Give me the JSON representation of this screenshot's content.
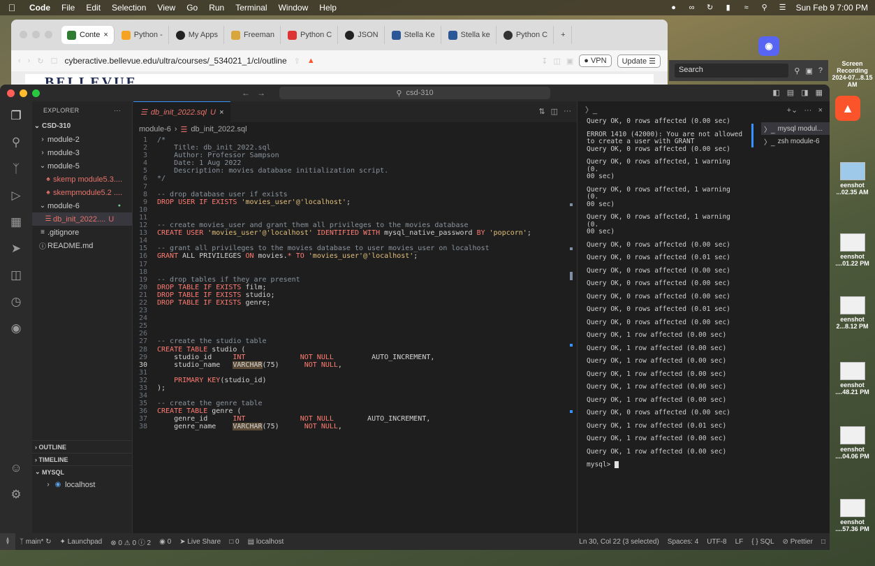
{
  "menubar": {
    "items": [
      "Code",
      "File",
      "Edit",
      "Selection",
      "View",
      "Go",
      "Run",
      "Terminal",
      "Window",
      "Help"
    ],
    "clock": "Sun Feb 9  7:00 PM"
  },
  "browser": {
    "tabs": [
      "Conte",
      "Python -",
      "My Apps",
      "Freeman",
      "Python C",
      "JSON",
      "Stella Ke",
      "Stella ke",
      "Python C"
    ],
    "url": "cyberactive.bellevue.edu/ultra/courses/_534021_1/cl/outline",
    "vpn": "VPN",
    "update": "Update",
    "logo": "BELLEVUE"
  },
  "widget": {
    "search": "Search"
  },
  "vscode": {
    "command_center": "csd-310",
    "explorer": {
      "header": "EXPLORER",
      "root": "CSD-310",
      "items": [
        {
          "label": "module-2",
          "indent": 1,
          "icon": "chevron-right"
        },
        {
          "label": "module-3",
          "indent": 1,
          "icon": "chevron-right"
        },
        {
          "label": "module-5",
          "indent": 1,
          "icon": "chevron-down"
        },
        {
          "label": "skemp module5.3....",
          "indent": 2,
          "icon": "python"
        },
        {
          "label": "skempmodule5.2 ....",
          "indent": 2,
          "icon": "python"
        },
        {
          "label": "module-6",
          "indent": 1,
          "icon": "chevron-down"
        },
        {
          "label": "db_init_2022....",
          "indent": 2,
          "icon": "sql",
          "badge": "U"
        },
        {
          "label": ".gitignore",
          "indent": 1,
          "icon": "lines"
        },
        {
          "label": "README.md",
          "indent": 1,
          "icon": "info"
        }
      ],
      "sections": [
        "OUTLINE",
        "TIMELINE",
        "MYSQL"
      ],
      "mysql_host": "localhost"
    },
    "editor": {
      "tab": "db_init_2022.sql",
      "tab_badge": "U",
      "breadcrumb_folder": "module-6",
      "breadcrumb_file": "db_init_2022.sql",
      "lines": [
        [
          [
            "c-com",
            "/*"
          ]
        ],
        [
          [
            "c-com",
            "    Title: db_init_2022.sql"
          ]
        ],
        [
          [
            "c-com",
            "    Author: Professor Sampson"
          ]
        ],
        [
          [
            "c-com",
            "    Date: 1 Aug 2022"
          ]
        ],
        [
          [
            "c-com",
            "    Description: movies database initialization script."
          ]
        ],
        [
          [
            "c-com",
            "*/"
          ]
        ],
        [],
        [
          [
            "c-com",
            "-- drop database user if exists"
          ]
        ],
        [
          [
            "c-kw",
            "DROP USER IF EXISTS "
          ],
          [
            "c-str",
            "'movies_user'@'localhost'"
          ],
          [
            "c-id",
            ";"
          ]
        ],
        [],
        [],
        [
          [
            "c-com",
            "-- create movies_user and grant them all privileges to the movies database"
          ]
        ],
        [
          [
            "c-kw",
            "CREATE USER "
          ],
          [
            "c-str",
            "'movies_user'@'localhost'"
          ],
          [
            "c-kw",
            " IDENTIFIED WITH "
          ],
          [
            "c-id",
            "mysql_native_password "
          ],
          [
            "c-kw",
            "BY "
          ],
          [
            "c-str",
            "'popcorn'"
          ],
          [
            "c-id",
            ";"
          ]
        ],
        [],
        [
          [
            "c-com",
            "-- grant all privileges to the movies database to user movies_user on localhost"
          ]
        ],
        [
          [
            "c-kw",
            "GRANT "
          ],
          [
            "c-id",
            "ALL PRIVILEGES "
          ],
          [
            "c-kw",
            "ON "
          ],
          [
            "c-id",
            "movies."
          ],
          [
            "c-kw",
            "*"
          ],
          [
            "c-kw",
            " TO "
          ],
          [
            "c-str",
            "'movies_user'@'localhost'"
          ],
          [
            "c-id",
            ";"
          ]
        ],
        [],
        [],
        [
          [
            "c-com",
            "-- drop tables if they are present"
          ]
        ],
        [
          [
            "c-kw",
            "DROP TABLE IF EXISTS "
          ],
          [
            "c-id",
            "film;"
          ]
        ],
        [
          [
            "c-kw",
            "DROP TABLE IF EXISTS "
          ],
          [
            "c-id",
            "studio;"
          ]
        ],
        [
          [
            "c-kw",
            "DROP TABLE IF EXISTS "
          ],
          [
            "c-id",
            "genre;"
          ]
        ],
        [],
        [],
        [],
        [],
        [
          [
            "c-com",
            "-- create the studio table"
          ]
        ],
        [
          [
            "c-kw",
            "CREATE TABLE "
          ],
          [
            "c-id",
            "studio ("
          ]
        ],
        [
          [
            "c-id",
            "    studio_id     "
          ],
          [
            "c-ty",
            "INT"
          ],
          [
            "c-id",
            "             "
          ],
          [
            "c-kw",
            "NOT NULL"
          ],
          [
            "c-id",
            "         AUTO_INCREMENT,"
          ]
        ],
        [
          [
            "c-id",
            "    studio_name   "
          ],
          [
            "c-hl",
            "VARCHAR"
          ],
          [
            "c-id",
            "(75)      "
          ],
          [
            "c-kw",
            "NOT NULL"
          ],
          [
            "c-id",
            ","
          ]
        ],
        [],
        [
          [
            "c-id",
            "    "
          ],
          [
            "c-kw",
            "PRIMARY KEY"
          ],
          [
            "c-id",
            "(studio_id)"
          ]
        ],
        [
          [
            "c-id",
            ");"
          ]
        ],
        [],
        [
          [
            "c-com",
            "-- create the genre table"
          ]
        ],
        [
          [
            "c-kw",
            "CREATE TABLE "
          ],
          [
            "c-id",
            "genre ("
          ]
        ],
        [
          [
            "c-id",
            "    genre_id      "
          ],
          [
            "c-ty",
            "INT"
          ],
          [
            "c-id",
            "             "
          ],
          [
            "c-kw",
            "NOT NULL"
          ],
          [
            "c-id",
            "        AUTO_INCREMENT,"
          ]
        ],
        [
          [
            "c-id",
            "    genre_name    "
          ],
          [
            "c-hl",
            "VARCHAR"
          ],
          [
            "c-id",
            "(75)      "
          ],
          [
            "c-kw",
            "NOT NULL"
          ],
          [
            "c-id",
            ","
          ]
        ]
      ],
      "current_line": 30
    },
    "terminal": {
      "output": [
        "Query OK, 0 rows affected (0.00 sec)",
        "",
        "ERROR 1410 (42000): You are not allowed\nto create a user with GRANT",
        "Query OK, 0 rows affected (0.00 sec)",
        "",
        "Query OK, 0 rows affected, 1 warning (0.\n00 sec)",
        "",
        "Query OK, 0 rows affected, 1 warning (0.\n00 sec)",
        "",
        "Query OK, 0 rows affected, 1 warning (0.\n00 sec)",
        "",
        "Query OK, 0 rows affected (0.00 sec)",
        "",
        "Query OK, 0 rows affected (0.01 sec)",
        "",
        "Query OK, 0 rows affected (0.00 sec)",
        "",
        "Query OK, 0 rows affected (0.00 sec)",
        "",
        "Query OK, 0 rows affected (0.00 sec)",
        "",
        "Query OK, 0 rows affected (0.01 sec)",
        "",
        "Query OK, 0 rows affected (0.00 sec)",
        "",
        "Query OK, 1 row affected (0.00 sec)",
        "",
        "Query OK, 1 row affected (0.00 sec)",
        "",
        "Query OK, 1 row affected (0.00 sec)",
        "",
        "Query OK, 1 row affected (0.00 sec)",
        "",
        "Query OK, 1 row affected (0.00 sec)",
        "",
        "Query OK, 1 row affected (0.00 sec)",
        "",
        "Query OK, 0 rows affected (0.00 sec)",
        "",
        "Query OK, 1 row affected (0.01 sec)",
        "",
        "Query OK, 1 row affected (0.00 sec)",
        "",
        "Query OK, 1 row affected (0.00 sec)",
        ""
      ],
      "prompt": "mysql> ",
      "sessions": [
        "mysql modul...",
        "zsh module-6"
      ]
    },
    "status": {
      "branch": "main*",
      "launchpad": "Launchpad",
      "problems": "⊗ 0 ⚠ 0 ⓘ 2",
      "ports": "0",
      "liveshare": "Live Share",
      "zero": "0",
      "db": "localhost",
      "position": "Ln 30, Col 22 (3 selected)",
      "spaces": "Spaces: 4",
      "encoding": "UTF-8",
      "eol": "LF",
      "lang": "SQL",
      "prettier": "Prettier"
    }
  },
  "desktop": {
    "items": [
      {
        "label": "Screen Recording\n2024-07...8.15 AM"
      },
      {
        "label": "eenshot\n...02.35 AM"
      },
      {
        "label": "eenshot\n....01.22 PM"
      },
      {
        "label": "eenshot\n2...8.12 PM"
      },
      {
        "label": "eenshot\n....48.21 PM"
      },
      {
        "label": "eenshot\n....04.06 PM"
      },
      {
        "label": "eenshot\n....57.36 PM"
      }
    ]
  },
  "colors": {
    "accent": "#3794ff",
    "git_untracked": "#e8736a",
    "keyword": "#ff7b72",
    "string": "#e3c07b",
    "comment": "#8b949e"
  }
}
